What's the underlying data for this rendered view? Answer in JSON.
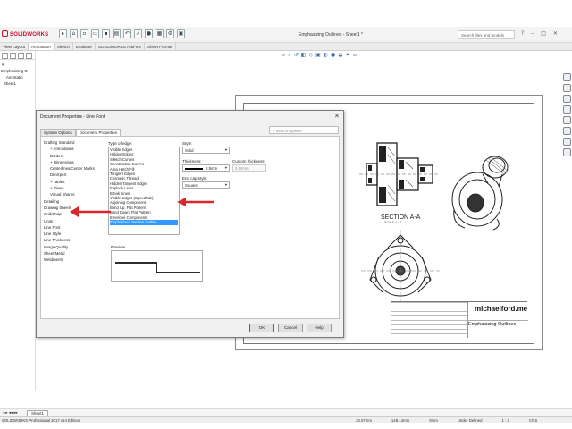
{
  "app": {
    "brand": "SOLIDWORKS",
    "document_title": "Emphasizing Outlines - Sheet1 *",
    "search_placeholder": "Search files and models",
    "window_buttons": [
      "?",
      "–",
      "□",
      "✕"
    ]
  },
  "command_tabs": [
    "View Layout",
    "Annotation",
    "Sketch",
    "Evaluate",
    "SOLIDWORKS Add-Ins",
    "Sheet Format"
  ],
  "active_tab_index": 1,
  "feature_tree": {
    "items": [
      "Emphasizing O",
      "Annotatio",
      "Sheet1"
    ]
  },
  "dialog": {
    "title": "Document Properties - Line Font",
    "tabs": [
      "System Options",
      "Document Properties"
    ],
    "active_tab_index": 1,
    "search_placeholder": "Search Options",
    "categories": [
      {
        "label": "Drafting Standard",
        "indent": 0
      },
      {
        "label": "Annotations",
        "indent": 1,
        "expander": "+"
      },
      {
        "label": "Borders",
        "indent": 1
      },
      {
        "label": "Dimensions",
        "indent": 1,
        "expander": "+"
      },
      {
        "label": "Centerlines/Center Marks",
        "indent": 1
      },
      {
        "label": "DimXpert",
        "indent": 1
      },
      {
        "label": "Tables",
        "indent": 1,
        "expander": "+"
      },
      {
        "label": "Views",
        "indent": 1,
        "expander": "+"
      },
      {
        "label": "Virtual Sharps",
        "indent": 1
      },
      {
        "label": "Detailing",
        "indent": 0
      },
      {
        "label": "Drawing Sheets",
        "indent": 0
      },
      {
        "label": "Grid/Snap",
        "indent": 0
      },
      {
        "label": "Units",
        "indent": 0
      },
      {
        "label": "Line Font",
        "indent": 0,
        "selected": true
      },
      {
        "label": "Line Style",
        "indent": 0
      },
      {
        "label": "Line Thickness",
        "indent": 0
      },
      {
        "label": "Image Quality",
        "indent": 0
      },
      {
        "label": "Sheet Metal",
        "indent": 0
      },
      {
        "label": "Weldments",
        "indent": 0
      }
    ],
    "type_of_edge_label": "Type of edge:",
    "edge_types": [
      "Visible Edges",
      "Hidden Edges",
      "Sketch Curves",
      "Construction Curves",
      "Area Hatch/Fill",
      "Tangent Edges",
      "Cosmetic Thread",
      "Hidden Tangent Edges",
      "Explode Lines",
      "Break Lines",
      "Visible Edges (SpeedPak)",
      "Adjoining Component",
      "Bend Up, Flat Pattern",
      "Bend Down, Flat Pattern",
      "Envelope Components",
      "Emphasized Section Outline"
    ],
    "selected_edge_index": 15,
    "style_label": "Style:",
    "style_value": "Solid",
    "thickness_label": "Thickness:",
    "thickness_value": "0.5mm",
    "custom_thickness_label": "Custom thickness:",
    "custom_thickness_value": "0.18mm",
    "end_cap_label": "End cap style:",
    "end_cap_value": "Square",
    "preview_label": "Preview",
    "buttons": [
      "OK",
      "Cancel",
      "Help"
    ]
  },
  "drawing": {
    "section_label": "SECTION A-A",
    "scale_label": "SCALE 1 : 1",
    "titleblock_logo": "michaelford.me",
    "titleblock_title": "Emphasizing Outlines"
  },
  "sheet_tab": "Sheet1",
  "status": {
    "left": "SOLIDWORKS Professional 2017 x64 Edition",
    "coords": [
      "33.07mm",
      "148.14mm",
      "0mm"
    ],
    "state": "Under Defined",
    "scale": "1 : 2",
    "units": "CGS"
  },
  "colors": {
    "accent_red": "#d9262a",
    "selection_blue": "#3399ff",
    "brand_red": "#c8102e"
  }
}
